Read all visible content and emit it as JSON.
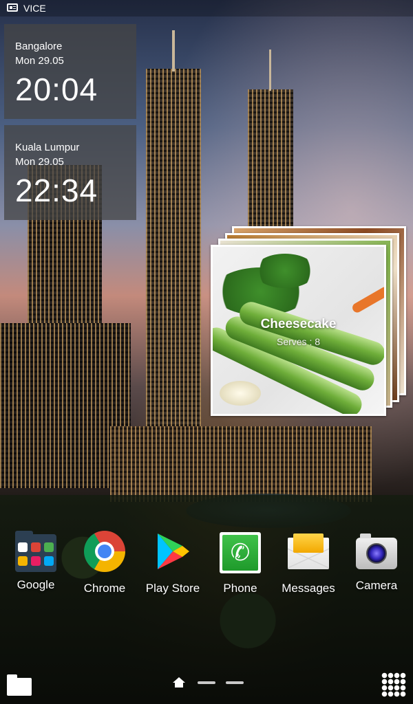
{
  "status_bar": {
    "app_name": "VICE"
  },
  "clocks": [
    {
      "city": "Bangalore",
      "date": "Mon  29.05",
      "time": "20:04"
    },
    {
      "city": "Kuala Lumpur",
      "date": "Mon  29.05",
      "time": "22:34"
    }
  ],
  "recipe_widget": {
    "title": "Cheesecake",
    "subtitle": "Serves : 8"
  },
  "dock": [
    {
      "label": "Google",
      "icon": "google-folder-icon"
    },
    {
      "label": "Chrome",
      "icon": "chrome-icon"
    },
    {
      "label": "Play Store",
      "icon": "play-store-icon"
    },
    {
      "label": "Phone",
      "icon": "phone-icon"
    },
    {
      "label": "Messages",
      "icon": "messages-icon"
    },
    {
      "label": "Camera",
      "icon": "camera-icon"
    }
  ],
  "colors": {
    "chrome_red": "#db4437",
    "chrome_yellow": "#f4b400",
    "chrome_green": "#0f9d58",
    "chrome_blue": "#4285f4",
    "phone_green": "#2fae3a"
  }
}
